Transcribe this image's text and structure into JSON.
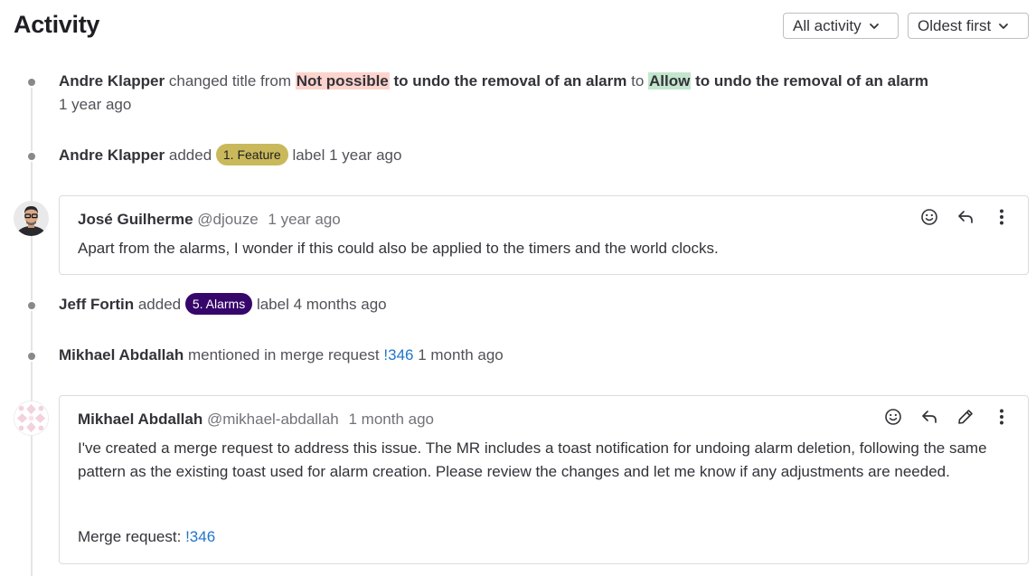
{
  "header": {
    "title": "Activity",
    "filter_label": "All activity",
    "sort_label": "Oldest first"
  },
  "events": {
    "title_change": {
      "author": "Andre Klapper",
      "pre": "changed title from",
      "old_changed": "Not possible",
      "old_rest": "to undo the removal of an alarm",
      "mid": "to",
      "new_changed": "Allow",
      "new_rest": "to undo the removal of an alarm",
      "time": "1 year ago"
    },
    "label_feature": {
      "author": "Andre Klapper",
      "action": "added",
      "label": "1. Feature",
      "label_color": "#c9b95a",
      "suffix": "label 1 year ago"
    },
    "label_alarms": {
      "author": "Jeff Fortin",
      "action": "added",
      "label": "5. Alarms",
      "label_color": "#36066b",
      "suffix": "label 4 months ago"
    },
    "mention": {
      "author": "Mikhael Abdallah",
      "text": "mentioned in merge request",
      "link": "!346",
      "time": "1 month ago"
    }
  },
  "notes": {
    "jose": {
      "author": "José Guilherme",
      "handle": "@djouze",
      "time": "1 year ago",
      "body": "Apart from the alarms, I wonder if this could also be applied to the timers and the world clocks."
    },
    "mikhael": {
      "author": "Mikhael Abdallah",
      "handle": "@mikhael-abdallah",
      "time": "1 month ago",
      "body": "I've created a merge request to address this issue. The MR includes a toast notification for undoing alarm deletion, following the same pattern as the existing toast used for alarm creation. Please review the changes and let me know if any adjustments are needed.",
      "mr_prefix": "Merge request:",
      "mr_link": "!346"
    }
  },
  "icons": [
    "chevron-down-icon",
    "smiley-icon",
    "reply-icon",
    "pencil-icon",
    "kebab-icon"
  ],
  "colors": {
    "link": "#1f75cb",
    "diff_removed": "#fdd4cd",
    "diff_added": "#c3e6cd"
  }
}
